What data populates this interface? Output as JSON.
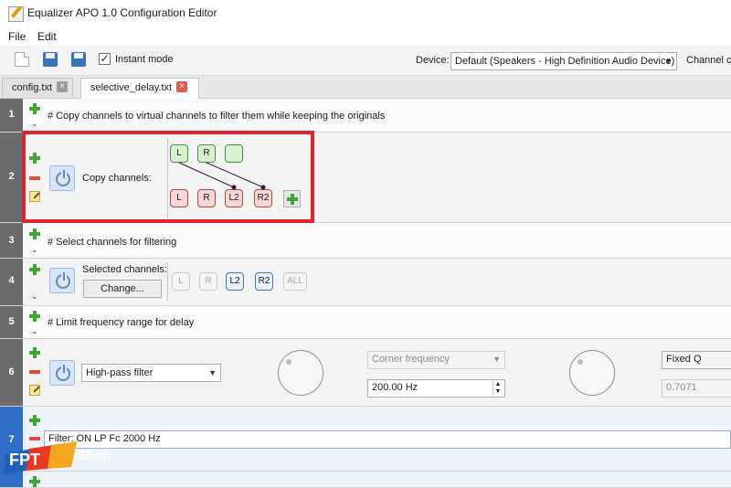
{
  "window": {
    "title": "Equalizer APO 1.0 Configuration Editor"
  },
  "menu": {
    "file": "File",
    "edit": "Edit"
  },
  "toolbar": {
    "instant_mode_label": "Instant mode",
    "instant_mode_checked": true,
    "check_glyph": "✓",
    "device_label": "Device:",
    "device_value": "Default (Speakers - High Definition Audio Device)",
    "channel_label": "Channel co"
  },
  "tabs": [
    {
      "label": "config.txt",
      "active": false,
      "close": "×"
    },
    {
      "label": "selective_delay.txt",
      "active": true,
      "close": "×"
    }
  ],
  "rows": {
    "r1": {
      "num": "1",
      "comment": "# Copy channels to virtual channels to filter them while keeping the originals"
    },
    "r2": {
      "num": "2",
      "label": "Copy channels:",
      "sources": [
        "L",
        "R",
        ""
      ],
      "targets": [
        "L",
        "R",
        "L2",
        "R2"
      ]
    },
    "r3": {
      "num": "3",
      "comment": "# Select channels for filtering"
    },
    "r4": {
      "num": "4",
      "label": "Selected channels:",
      "change_button": "Change...",
      "channels": [
        "L",
        "R",
        "L2",
        "R2",
        "ALL"
      ]
    },
    "r5": {
      "num": "5",
      "comment": "# Limit frequency range for delay"
    },
    "r6": {
      "num": "6",
      "filter_type": "High-pass filter",
      "corner_frequency_label": "Corner frequency",
      "corner_frequency_value": "200.00 Hz",
      "q_type": "Fixed Q",
      "q_value": "0.7071"
    },
    "r7": {
      "num": "7",
      "value": "Filter: ON LP Fc 2000 Hz"
    }
  },
  "icons": {
    "app": "pencil-notepad-icon",
    "new": "new-file-icon",
    "save": "save-icon",
    "save_as": "save-as-icon",
    "add": "plus-icon",
    "remove": "minus-icon",
    "edit": "pencil-icon",
    "expand": "chevron-down-icon",
    "power": "power-icon"
  },
  "colors": {
    "highlight": "#e3242b",
    "selected_row": "#2e6dc7",
    "add": "#3fa834",
    "remove": "#e04a3f"
  },
  "watermark": {
    "brand": "FPT",
    "sub": "Shop"
  }
}
